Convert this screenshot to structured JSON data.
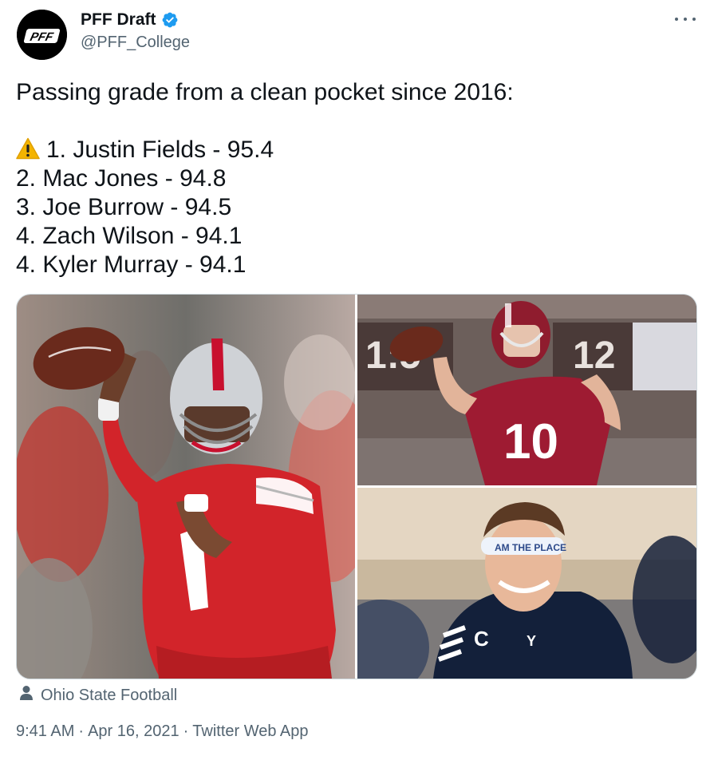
{
  "tweet": {
    "display_name": "PFF Draft",
    "handle": "@PFF_College",
    "avatar_label": "PFF",
    "lines": [
      "Passing grade from a clean pocket since 2016:",
      "1. Justin Fields - 95.4",
      "2. Mac Jones - 94.8",
      "3. Joe Burrow - 94.5",
      "4. Zach Wilson - 94.1",
      "4. Kyler Murray - 94.1"
    ],
    "media_credit": "Ohio State Football",
    "time": "9:41 AM",
    "date": "Apr 16, 2021",
    "client": "Twitter Web App",
    "separator": "·"
  },
  "photos": {
    "p2_scoreboard_left": "1:5",
    "p2_scoreboard_right": "12",
    "p3_headband": "AM THE PLACE",
    "p3_jersey_letter": "C",
    "p3_logo": "Y"
  },
  "icons": {
    "verified": "verified-badge-icon",
    "more": "more-options-icon",
    "warning": "warning-emoji-icon",
    "person": "person-icon"
  },
  "colors": {
    "verified_blue": "#1d9bf0",
    "secondary_text": "#536471",
    "ohio_state_red": "#c8102e",
    "alabama_crimson": "#9e1b32",
    "byu_navy": "#13203a"
  }
}
